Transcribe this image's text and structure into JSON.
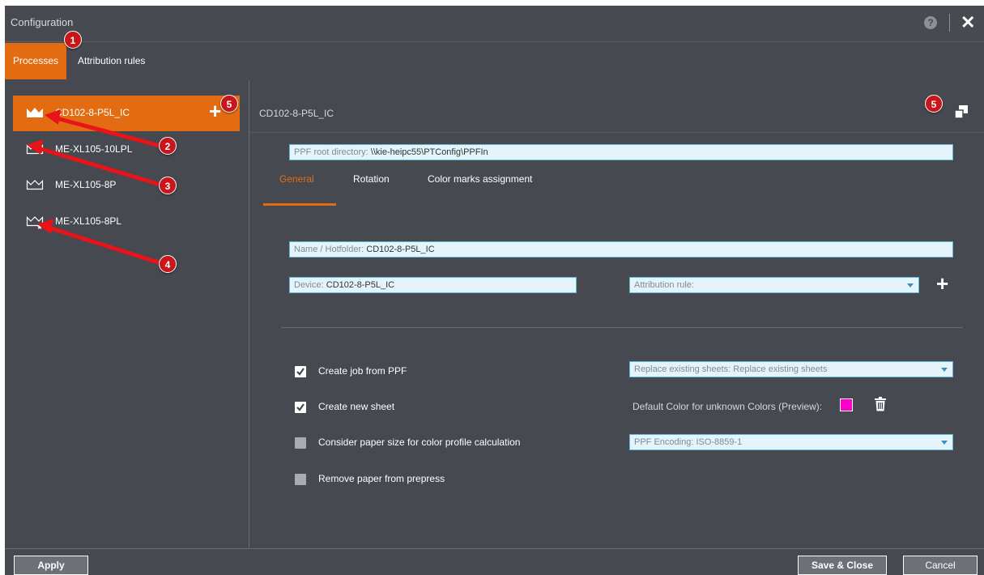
{
  "window": {
    "title": "Configuration",
    "help_icon": "?",
    "close_icon": "✕"
  },
  "tabs": [
    {
      "label": "Processes",
      "active": true
    },
    {
      "label": "Attribution rules",
      "active": false
    }
  ],
  "processes": [
    {
      "label": "CD102-8-P5L_IC",
      "active": true,
      "icon": "crown-filled-icon"
    },
    {
      "label": "ME-XL105-10LPL",
      "active": false,
      "icon": "crown-outline-icon"
    },
    {
      "label": "ME-XL105-8P",
      "active": false,
      "icon": "crown-outline-icon"
    },
    {
      "label": "ME-XL105-8PL",
      "active": false,
      "icon": "crown-star-icon"
    }
  ],
  "add_process_icon": "+",
  "detail": {
    "title": "CD102-8-P5L_IC",
    "ppf_root": {
      "label": "PPF root directory:",
      "value": "\\\\kie-heipc55\\PTConfig\\PPFIn"
    },
    "subtabs": [
      {
        "label": "General",
        "active": true
      },
      {
        "label": "Rotation",
        "active": false
      },
      {
        "label": "Color marks assignment",
        "active": false
      }
    ],
    "name_hotfolder": {
      "label": "Name / Hotfolder:",
      "value": "CD102-8-P5L_IC"
    },
    "device": {
      "label": "Device:",
      "value": "CD102-8-P5L_IC"
    },
    "attribution_rule": {
      "label": "Attribution rule:",
      "value": ""
    },
    "add_rule_icon": "+",
    "options": [
      {
        "label": "Create job from PPF",
        "checked": true
      },
      {
        "label": "Create new sheet",
        "checked": true
      },
      {
        "label": "Consider paper size for color profile calculation",
        "checked": false
      },
      {
        "label": "Remove paper from prepress",
        "checked": false
      }
    ],
    "replace_existing": {
      "label": "Replace existing sheets:",
      "value": "Replace existing sheets"
    },
    "default_color": {
      "label": "Default Color for unknown Colors (Preview):",
      "color": "#ff00cc"
    },
    "ppf_encoding": {
      "label": "PPF Encoding:",
      "value": "ISO-8859-1"
    }
  },
  "buttons": {
    "apply": "Apply",
    "save_close": "Save & Close",
    "cancel": "Cancel"
  },
  "callouts": [
    "1",
    "2",
    "3",
    "4",
    "5",
    "5"
  ],
  "colors": {
    "accent": "#e36c13",
    "background": "#464950",
    "field_bg": "#e4f4fa",
    "field_border": "#5fb9de",
    "callout": "#c8161a"
  }
}
